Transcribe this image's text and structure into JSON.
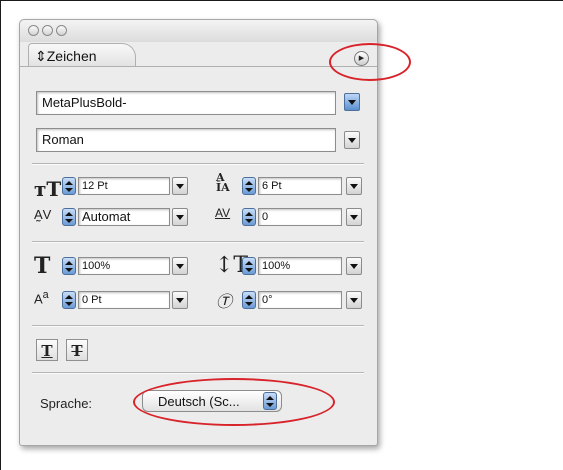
{
  "panel": {
    "tab_label": "Zeichen",
    "font_family": "MetaPlusBold-",
    "font_style": "Roman",
    "font_size": "12 Pt",
    "leading": "6 Pt",
    "kerning": "Automat",
    "tracking": "0",
    "vertical_scale": "100%",
    "horizontal_scale": "100%",
    "baseline_shift": "0 Pt",
    "skew": "0°",
    "language_label": "Sprache:",
    "language_value": "Deutsch (Sc..."
  },
  "icons": {
    "font_size": "font-size-icon",
    "leading": "leading-icon",
    "kerning": "kerning-icon",
    "tracking": "tracking-icon",
    "vertical_scale": "vertical-scale-icon",
    "horizontal_scale": "horizontal-scale-icon",
    "baseline_shift": "baseline-shift-icon",
    "skew": "skew-icon",
    "underline": "underline-icon",
    "strikethrough": "strikethrough-icon",
    "panel_menu": "panel-menu-icon"
  },
  "colors": {
    "highlight": "#d8232a",
    "accent_blue": "#5b8fd1"
  }
}
